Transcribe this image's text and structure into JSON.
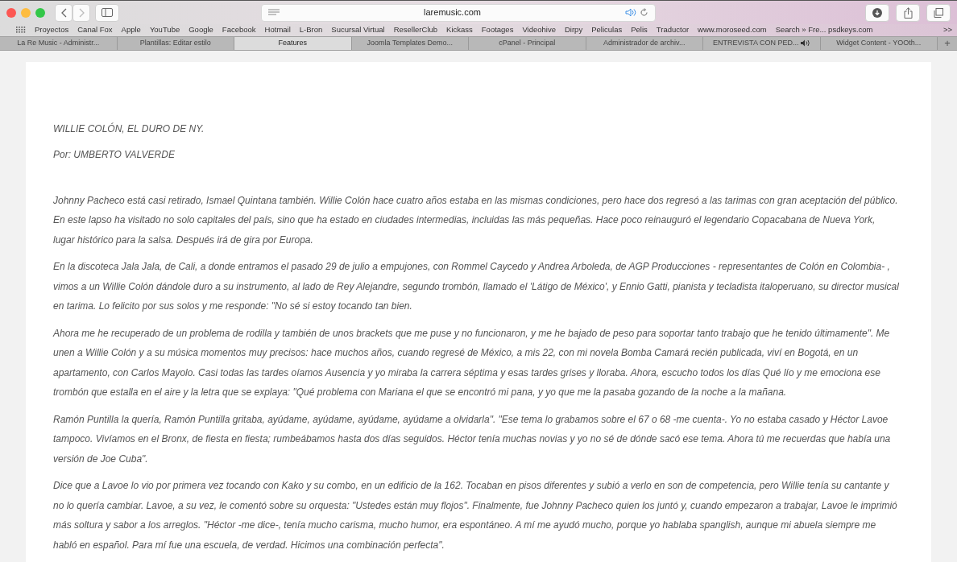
{
  "toolbar": {
    "address": "laremusic.com"
  },
  "bookmarks": [
    "Proyectos",
    "Canal Fox",
    "Apple",
    "YouTube",
    "Google",
    "Facebook",
    "Hotmail",
    "L-Bron",
    "Sucursal Virtual",
    "ResellerClub",
    "Kickass",
    "Footages",
    "Videohive",
    "Dirpy",
    "Peliculas",
    "Pelis",
    "Traductor",
    "www.moroseed.com",
    "Search » Fre... psdkeys.com"
  ],
  "bookmarks_more": ">>",
  "tabs": [
    {
      "label": "La Re Music - Administr...",
      "selected": false,
      "audio": false
    },
    {
      "label": "Plantillas: Editar estilo",
      "selected": false,
      "audio": false
    },
    {
      "label": "Features",
      "selected": true,
      "audio": false
    },
    {
      "label": "Joomla Templates Demo...",
      "selected": false,
      "audio": false
    },
    {
      "label": "cPanel - Principal",
      "selected": false,
      "audio": false
    },
    {
      "label": "Administrador de archiv...",
      "selected": false,
      "audio": false
    },
    {
      "label": "ENTREVISTA CON PED...",
      "selected": false,
      "audio": true
    },
    {
      "label": "Widget Content - YOOth...",
      "selected": false,
      "audio": false
    }
  ],
  "new_tab": "+",
  "article": {
    "title": "WILLIE COLÓN, EL DURO DE NY.",
    "byline": "Por: UMBERTO VALVERDE",
    "paragraphs": [
      "Johnny Pacheco está casi retirado, Ismael Quintana también. Willie Colón hace cuatro años estaba en las mismas condiciones, pero hace dos regresó a las tarimas con gran aceptación del público. En este lapso ha visitado no solo capitales del país, sino que ha estado en ciudades intermedias, incluidas las más pequeñas. Hace poco reinauguró el legendario Copacabana de Nueva York, lugar histórico para la salsa. Después irá de gira por Europa.",
      "En la discoteca Jala Jala, de Cali, a donde entramos el pasado 29 de julio a empujones, con Rommel Caycedo y Andrea Arboleda, de AGP Producciones - representantes de Colón en Colombia- , vimos a un Willie Colón dándole duro a su instrumento, al lado de Rey Alejandre, segundo trombón, llamado el 'Látigo de México', y Ennio Gatti, pianista y tecladista italoperuano, su director musical en tarima. Lo felicito por sus solos y me responde: \"No sé si estoy tocando tan bien.",
      "Ahora me he recuperado de un problema de rodilla y también de unos brackets que me puse y no funcionaron, y me he bajado de peso para soportar tanto trabajo que he tenido últimamente\". Me unen a Willie Colón y a su música momentos muy precisos: hace muchos años, cuando regresé de México, a mis 22, con mi novela Bomba Camará recién publicada, viví en Bogotá, en un apartamento, con Carlos Mayolo. Casi todas las tardes oíamos Ausencia y yo miraba la carrera séptima y esas tardes grises y lloraba. Ahora, escucho todos los días Qué lío y me emociona ese trombón que estalla en el aire y la letra que se explaya: \"Qué problema con Mariana el que se encontró mi pana, y yo que me la pasaba gozando de la noche a la mañana.",
      "Ramón Puntilla la quería, Ramón Puntilla gritaba, ayúdame, ayúdame, ayúdame, ayúdame a olvidarla\". \"Ese tema lo grabamos sobre el 67 o 68 -me cuenta-. Yo no estaba casado y Héctor Lavoe tampoco. Vivíamos en el Bronx, de fiesta en fiesta; rumbeábamos hasta dos días seguidos. Héctor tenía muchas novias y yo no sé de dónde sacó ese tema. Ahora tú me recuerdas que había una versión de Joe Cuba\".",
      "Dice que a Lavoe lo vio por primera vez tocando con Kako y su combo, en un edificio de la 162. Tocaban en pisos diferentes y subió a verlo en son de competencia, pero Willie tenía su cantante y no lo quería cambiar. Lavoe, a su vez, le comentó sobre su orquesta: \"Ustedes están muy flojos\". Finalmente, fue Johnny Pacheco quien los juntó y, cuando empezaron a trabajar, Lavoe le imprimió más soltura y sabor a los arreglos. \"Héctor -me dice-, tenía mucho carisma, mucho humor, era espontáneo. A mí me ayudó mucho, porque yo hablaba spanglish, aunque mi abuela siempre me habló en español. Para mí fue una escuela, de verdad. Hicimos una combinación perfecta\"."
    ]
  }
}
